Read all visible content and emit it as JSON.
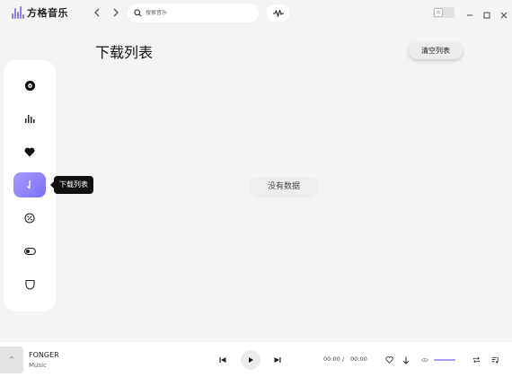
{
  "app": {
    "title": "方格音乐"
  },
  "header": {
    "search_placeholder": "搜索音乐",
    "theme_icon": "sun-icon"
  },
  "sidebar": {
    "items": [
      {
        "icon": "disc-icon"
      },
      {
        "icon": "chart-bars-icon"
      },
      {
        "icon": "heart-icon"
      },
      {
        "icon": "download-icon",
        "active": true,
        "tooltip": "下载列表"
      },
      {
        "icon": "percent-icon"
      },
      {
        "icon": "toggle-icon"
      },
      {
        "icon": "shield-icon"
      }
    ]
  },
  "main": {
    "title": "下载列表",
    "clear_button": "清空列表",
    "empty_message": "没有数据"
  },
  "player": {
    "expand_label": "^",
    "song_title": "FONGER",
    "song_artist": "Music",
    "current_time": "00:00",
    "separator": "/",
    "total_time": "00:00",
    "volume_level": 1.0
  },
  "colors": {
    "accent": "#8e7cf0",
    "background": "#f4f4f4",
    "panel": "#ffffff"
  }
}
